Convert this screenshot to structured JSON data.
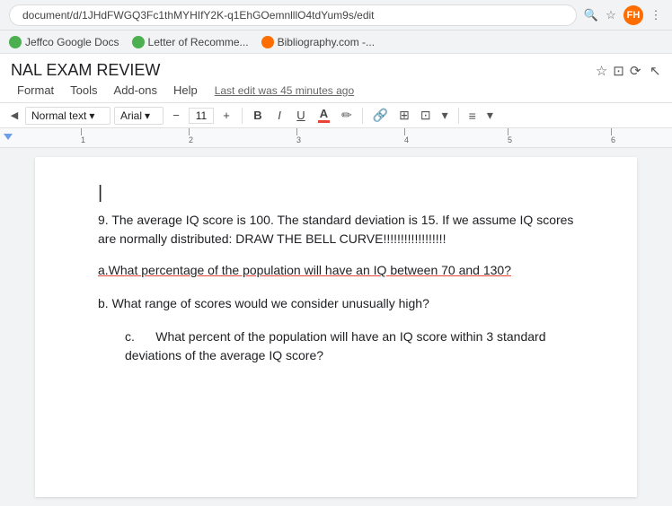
{
  "browser": {
    "url": "document/d/1JHdFWGQ3Fc1thMYHIfY2K-q1EhGOemnlllO4tdYum9s/edit",
    "bookmark1": "Jeffco Google Docs",
    "bookmark2": "Letter of Recomme...",
    "bookmark3": "Bibliography.com -...",
    "avatar_label": "FH"
  },
  "doc": {
    "title": "NAL EXAM REVIEW",
    "last_edit": "Last edit was 45 minutes ago",
    "menu": {
      "format": "Format",
      "tools": "Tools",
      "addons": "Add-ons",
      "help": "Help"
    },
    "toolbar": {
      "style": "Normal text",
      "font": "Arial",
      "font_size": "11",
      "bold": "B",
      "italic": "I",
      "underline": "U",
      "color_letter": "A",
      "minus": "−",
      "plus": "+"
    },
    "ruler": {
      "marks": [
        "1",
        "2",
        "3",
        "4",
        "5",
        "6"
      ]
    },
    "content": {
      "cursor": "|",
      "question9": "9. The average IQ score is 100.  The standard deviation is 15.  If we assume IQ scores are normally distributed: DRAW THE BELL CURVE!!!!!!!!!!!!!!!!!!",
      "qa": "a.What percentage of the population will have an IQ between 70 and 130?",
      "qb": "b. What range of scores would we consider unusually high?",
      "qc_label": "c.",
      "qc_text": "What percent of the population will have an IQ score within 3 standard deviations of the average IQ score?"
    }
  }
}
